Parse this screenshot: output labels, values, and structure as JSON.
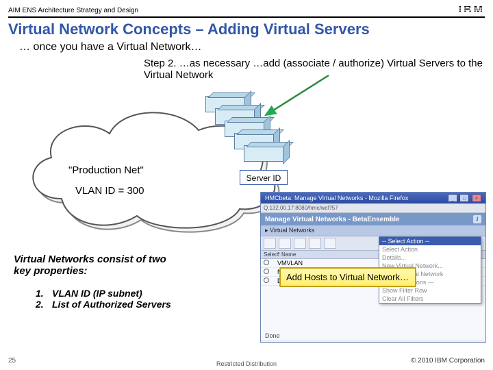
{
  "header": {
    "left": "AIM ENS Architecture Strategy and Design",
    "logo": "IBM"
  },
  "title": "Virtual Network Concepts – Adding Virtual Servers",
  "sub1": "… once you have a Virtual Network…",
  "sub2": "Step 2. …as necessary …add (associate / authorize) Virtual Servers to the Virtual Network",
  "cloud": {
    "name": "\"Production Net\"",
    "vlan": "VLAN ID = 300"
  },
  "server_id_label": "Server ID",
  "highlight": "Add Hosts to Virtual Network…",
  "properties": {
    "heading": "Virtual Networks consist of two key properties:",
    "items": [
      {
        "n": "1.",
        "t": "VLAN ID (IP subnet)"
      },
      {
        "n": "2.",
        "t": "List of Authorized Servers"
      }
    ]
  },
  "browser": {
    "window_title": "HMCbeta: Manage Virtual Networks - Mozilla Firefox",
    "url": "Q.132.00.17:8080/hmc/wcl?57",
    "panel_title": "Manage Virtual Networks - BetaEnsemble",
    "section": "Virtual Networks",
    "col_select": "Select",
    "col_name": "Name",
    "rows": [
      "VMVLAN",
      "NVM name will be here",
      "Default"
    ],
    "dropdown": {
      "header": "-- Select Action --",
      "options": [
        "Select Action",
        "Details...",
        "New Virtual Network...",
        "Delete Virtual Network",
        "--- Table Actions ---",
        "Show Filter Row",
        "Clear All Filters"
      ]
    },
    "done": "Done"
  },
  "footer": {
    "page": "25",
    "copyright": "© 2010 IBM Corporation",
    "restricted": "Restricted Distribution"
  }
}
